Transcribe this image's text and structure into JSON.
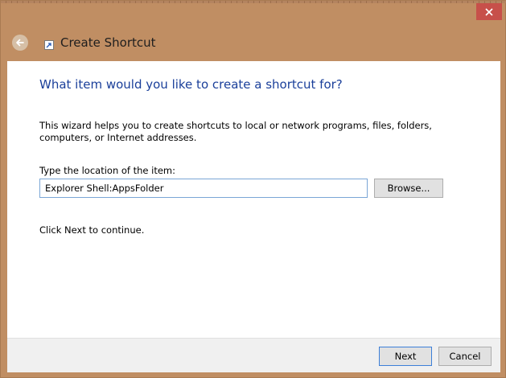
{
  "window": {
    "title": "Create Shortcut",
    "close_icon": "close-icon",
    "back_icon": "back-arrow-icon",
    "app_icon": "shortcut-icon",
    "colors": {
      "frame": "#c08e63",
      "close": "#c7504a",
      "heading": "#1a3f9a"
    }
  },
  "wizard": {
    "heading": "What item would you like to create a shortcut for?",
    "description": "This wizard helps you to create shortcuts to local or network programs, files, folders, computers, or Internet addresses.",
    "location_label": "Type the location of the item:",
    "location_value": "Explorer Shell:AppsFolder",
    "browse_label": "Browse...",
    "continue_text": "Click Next to continue."
  },
  "footer": {
    "next_label": "Next",
    "cancel_label": "Cancel"
  }
}
